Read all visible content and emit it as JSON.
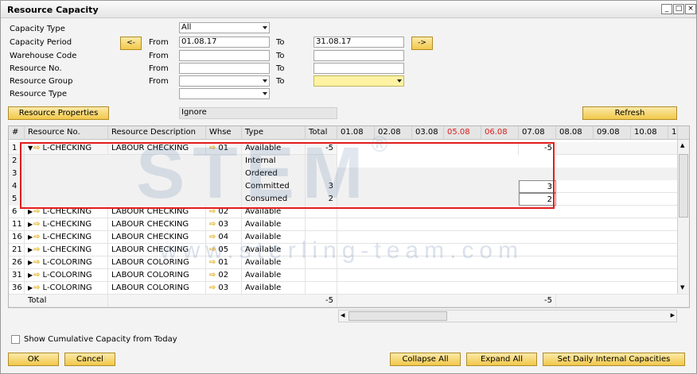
{
  "window": {
    "title": "Resource Capacity",
    "minimize": "_",
    "maximize": "□",
    "close": "×"
  },
  "filters": {
    "capacity_type_label": "Capacity Type",
    "capacity_type_value": "All",
    "capacity_period_label": "Capacity Period",
    "prev_btn": "<-",
    "next_btn": "->",
    "from_label": "From",
    "to_label": "To",
    "from_date": "01.08.17",
    "to_date": "31.08.17",
    "warehouse_label": "Warehouse Code",
    "resource_no_label": "Resource No.",
    "resource_group_label": "Resource Group",
    "resource_type_label": "Resource Type"
  },
  "toolbar": {
    "resource_properties": "Resource Properties",
    "ignore_value": "Ignore",
    "refresh": "Refresh"
  },
  "grid": {
    "headers": [
      "#",
      "Resource No.",
      "Resource Description",
      "Whse",
      "Type",
      "Total",
      "01.08",
      "02.08",
      "03.08",
      "05.08",
      "06.08",
      "07.08",
      "08.08",
      "09.08",
      "10.08",
      "1."
    ],
    "rows": [
      {
        "n": "1",
        "expanded": true,
        "res": "L-CHECKING",
        "desc": "LABOUR CHECKING",
        "whse": "01",
        "type": "Available",
        "total": "-5",
        "c0708": "-5"
      },
      {
        "n": "2",
        "sub": true,
        "type": "Internal",
        "total": "",
        "c0708": ""
      },
      {
        "n": "3",
        "sub": true,
        "type": "Ordered",
        "total": "",
        "c0708": ""
      },
      {
        "n": "4",
        "sub": true,
        "type": "Committed",
        "total": "3",
        "c0708": "3"
      },
      {
        "n": "5",
        "sub": true,
        "type": "Consumed",
        "total": "2",
        "c0708": "2"
      },
      {
        "n": "6",
        "res": "L-CHECKING",
        "desc": "LABOUR CHECKING",
        "whse": "02",
        "type": "Available",
        "total": "",
        "c0708": ""
      },
      {
        "n": "11",
        "res": "L-CHECKING",
        "desc": "LABOUR CHECKING",
        "whse": "03",
        "type": "Available",
        "total": "",
        "c0708": ""
      },
      {
        "n": "16",
        "res": "L-CHECKING",
        "desc": "LABOUR CHECKING",
        "whse": "04",
        "type": "Available",
        "total": "",
        "c0708": ""
      },
      {
        "n": "21",
        "res": "L-CHECKING",
        "desc": "LABOUR CHECKING",
        "whse": "05",
        "type": "Available",
        "total": "",
        "c0708": ""
      },
      {
        "n": "26",
        "res": "L-COLORING",
        "desc": "LABOUR COLORING",
        "whse": "01",
        "type": "Available",
        "total": "",
        "c0708": ""
      },
      {
        "n": "31",
        "res": "L-COLORING",
        "desc": "LABOUR COLORING",
        "whse": "02",
        "type": "Available",
        "total": "",
        "c0708": ""
      },
      {
        "n": "36",
        "res": "L-COLORING",
        "desc": "LABOUR COLORING",
        "whse": "03",
        "type": "Available",
        "total": "",
        "c0708": ""
      }
    ],
    "total_label": "Total",
    "total_value": "-5",
    "total_0708": "-5"
  },
  "watermark": {
    "big": "STEM",
    "site": "www.sterling-team.com",
    "reg": "®"
  },
  "footer": {
    "cumulative_label": "Show Cumulative Capacity from Today",
    "ok": "OK",
    "cancel": "Cancel",
    "collapse_all": "Collapse All",
    "expand_all": "Expand All",
    "set_daily": "Set Daily Internal Capacities"
  }
}
